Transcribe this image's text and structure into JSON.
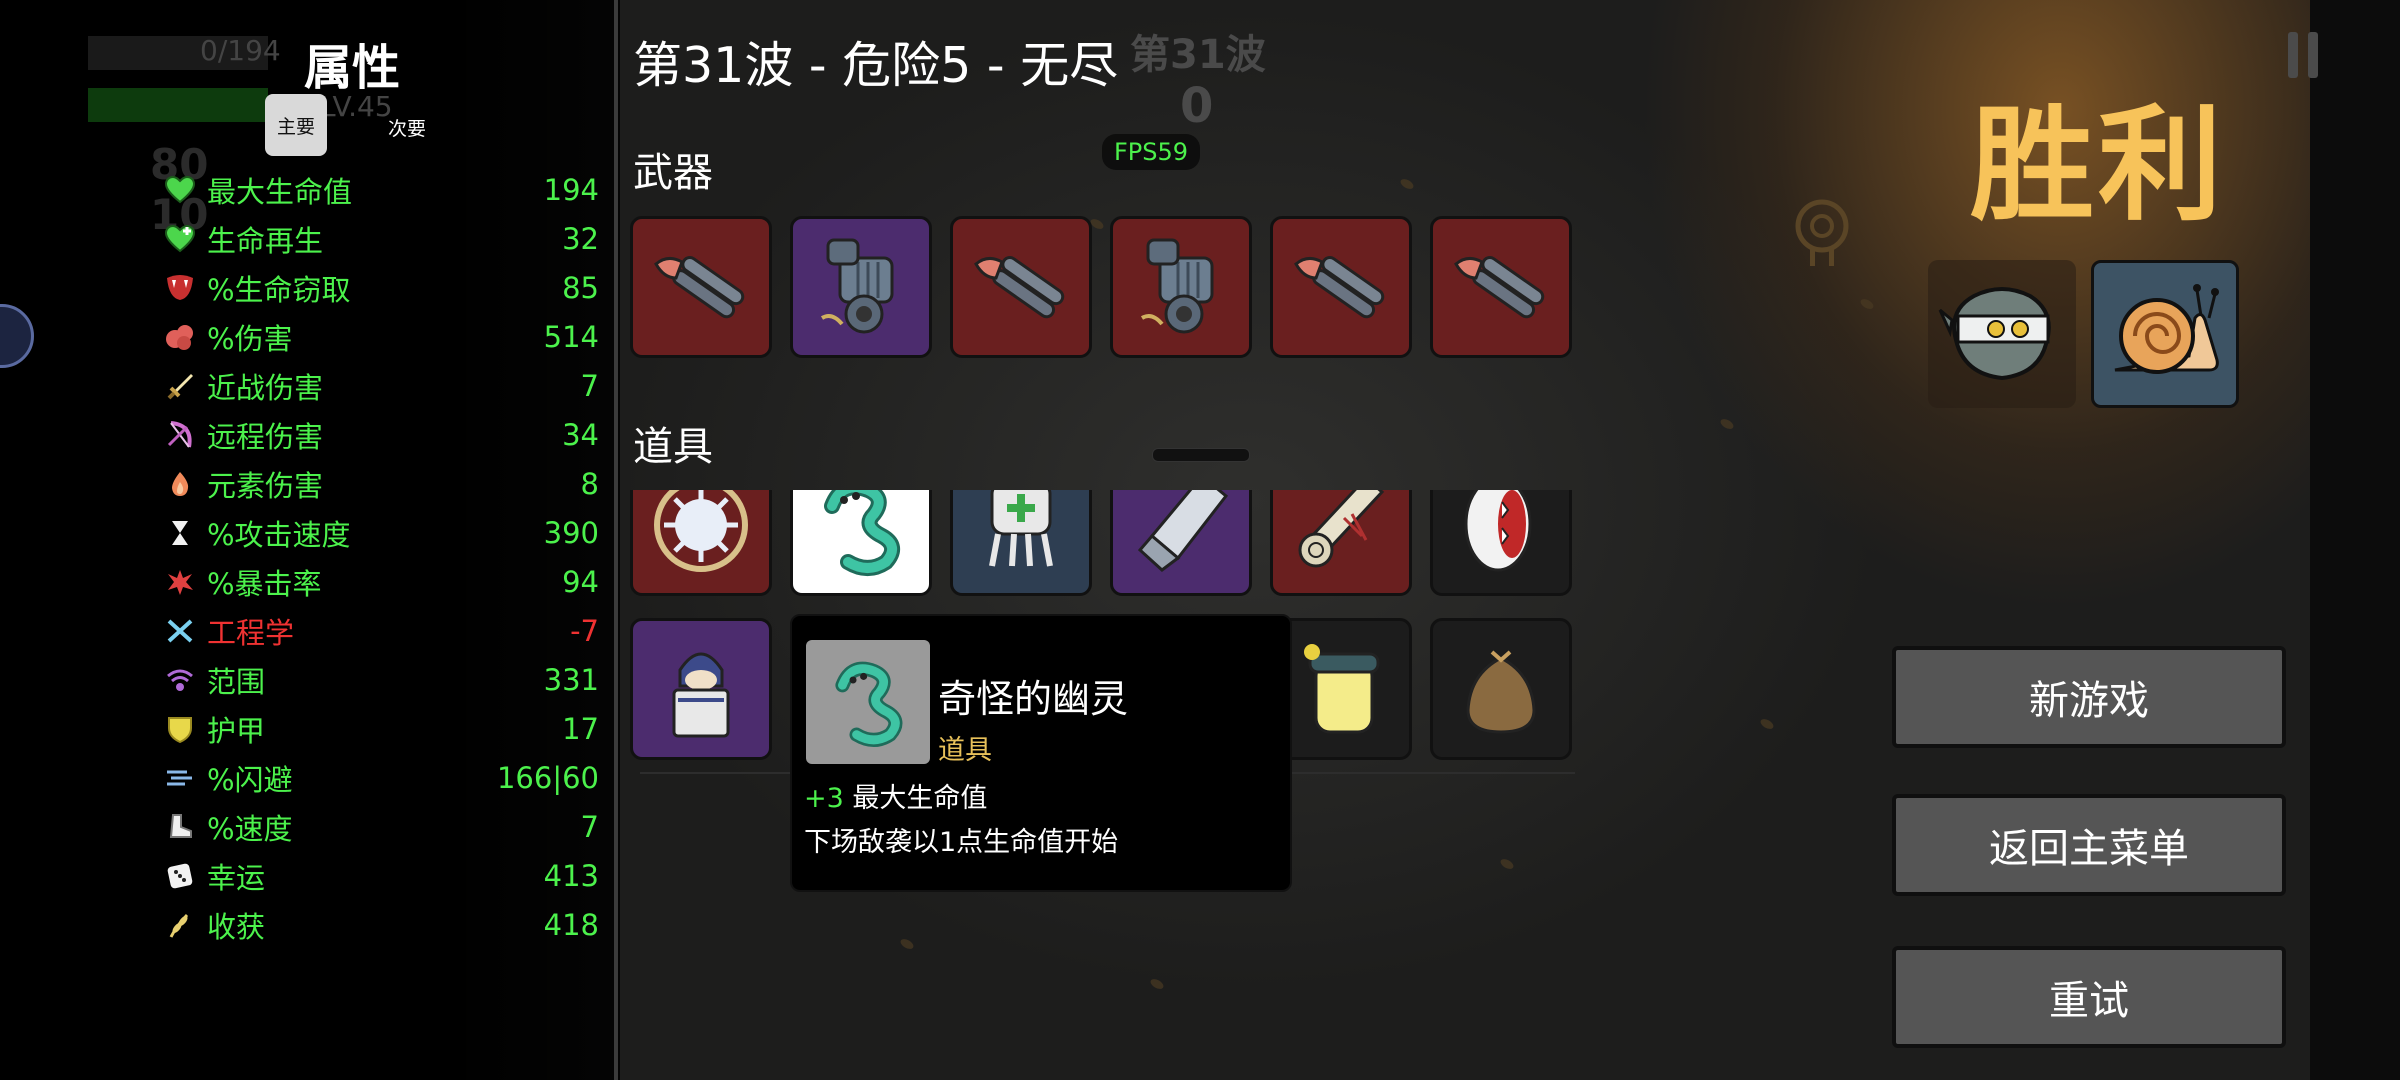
{
  "stats_panel": {
    "title": "属性",
    "tabs": {
      "primary": "主要",
      "secondary": "次要"
    },
    "background_hud": {
      "xp_text": "0/194",
      "level_text": "LV.45",
      "materials": "80",
      "bag": "10"
    },
    "stats": [
      {
        "icon": "heart-icon",
        "label": "最大生命值",
        "value": "194",
        "color": "#4cf24c"
      },
      {
        "icon": "heart-regen-icon",
        "label": "生命再生",
        "value": "32",
        "color": "#4cf24c"
      },
      {
        "icon": "fang-mouth-icon",
        "label": "%生命窃取",
        "value": "85",
        "color": "#4cf24c"
      },
      {
        "icon": "muscle-icon",
        "label": "%伤害",
        "value": "514",
        "color": "#4cf24c"
      },
      {
        "icon": "sword-icon",
        "label": "近战伤害",
        "value": "7",
        "color": "#4cf24c"
      },
      {
        "icon": "bow-icon",
        "label": "远程伤害",
        "value": "34",
        "color": "#4cf24c"
      },
      {
        "icon": "flame-icon",
        "label": "元素伤害",
        "value": "8",
        "color": "#4cf24c"
      },
      {
        "icon": "hourglass-icon",
        "label": "%攻击速度",
        "value": "390",
        "color": "#4cf24c"
      },
      {
        "icon": "crit-burst-icon",
        "label": "%暴击率",
        "value": "94",
        "color": "#4cf24c"
      },
      {
        "icon": "wrench-icon",
        "label": "工程学",
        "value": "-7",
        "color": "#f03232"
      },
      {
        "icon": "range-signal-icon",
        "label": "范围",
        "value": "331",
        "color": "#4cf24c"
      },
      {
        "icon": "shield-icon",
        "label": "护甲",
        "value": "17",
        "color": "#4cf24c"
      },
      {
        "icon": "dodge-wind-icon",
        "label": "%闪避",
        "value": "166|60",
        "color": "#4cf24c"
      },
      {
        "icon": "boot-icon",
        "label": "%速度",
        "value": "7",
        "color": "#4cf24c"
      },
      {
        "icon": "dice-icon",
        "label": "幸运",
        "value": "413",
        "color": "#4cf24c"
      },
      {
        "icon": "wheat-icon",
        "label": "收获",
        "value": "418",
        "color": "#4cf24c"
      }
    ]
  },
  "header": {
    "wave_title": "第31波 - 危险5 - 无尽",
    "hud_wave": "第31波",
    "hud_timer": "0",
    "fps": "FPS59"
  },
  "weapons": {
    "label": "武器",
    "slots": [
      {
        "icon": "double-barrel-shotgun-icon",
        "tier": "red"
      },
      {
        "icon": "minigun-icon",
        "tier": "purple"
      },
      {
        "icon": "double-barrel-shotgun-icon",
        "tier": "red"
      },
      {
        "icon": "minigun-icon",
        "tier": "red"
      },
      {
        "icon": "double-barrel-shotgun-icon",
        "tier": "red"
      },
      {
        "icon": "double-barrel-shotgun-icon",
        "tier": "red"
      }
    ]
  },
  "items": {
    "label": "道具",
    "row1": [
      {
        "icon": "spiked-orb-icon",
        "tier": "red"
      },
      {
        "icon": "strange-ghost-icon",
        "tier": "white"
      },
      {
        "icon": "medic-robot-icon",
        "tier": "blue"
      },
      {
        "icon": "blade-icon",
        "tier": "purple"
      },
      {
        "icon": "scroll-icon",
        "tier": "red"
      },
      {
        "icon": "fang-mouth-icon",
        "tier": "dark"
      }
    ],
    "row2": [
      {
        "icon": "hooded-merchant-icon",
        "tier": "purple"
      },
      {
        "icon": "lemonade-jar-icon",
        "tier": "dark"
      },
      {
        "icon": "poop-bag-icon",
        "tier": "dark"
      }
    ]
  },
  "tooltip": {
    "icon": "strange-ghost-icon",
    "name": "奇怪的幽灵",
    "type": "道具",
    "effect_value": "+3",
    "effect_stat": "最大生命值",
    "description": "下场敌袭以1点生命值开始"
  },
  "result": {
    "title": "胜利",
    "characters": [
      {
        "icon": "ninja-character-icon"
      },
      {
        "icon": "snail-character-icon"
      }
    ],
    "buttons": {
      "new_game": "新游戏",
      "main_menu": "返回主菜单",
      "retry": "重试"
    }
  },
  "colors": {
    "stat_green": "#4cf24c",
    "stat_red": "#f03232",
    "victory_gold": "#f7c35a",
    "tier_red": "#6a1f1f",
    "tier_purple": "#4c2c6e",
    "tier_blue": "#2e3e52"
  }
}
